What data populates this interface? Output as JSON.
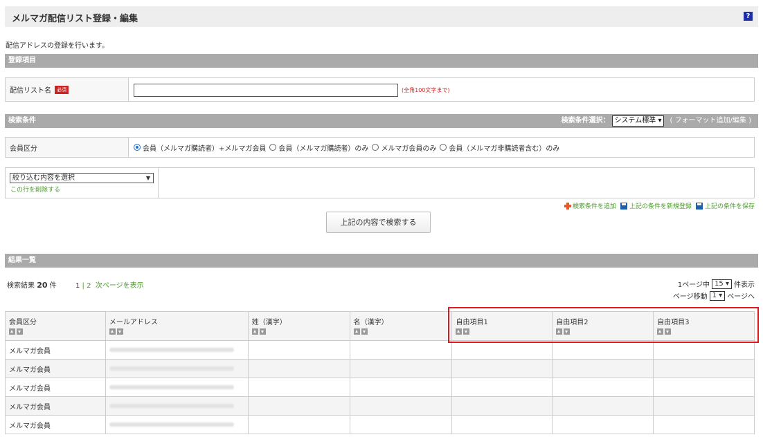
{
  "header": {
    "title": "メルマガ配信リスト登録・編集",
    "help_label": "?"
  },
  "description": "配信アドレスの登録を行います。",
  "registration": {
    "section_title": "登録項目",
    "list_name_label": "配信リスト名",
    "required_badge": "必須",
    "list_name_value": "",
    "input_note": "(全角100文字まで)"
  },
  "search": {
    "section_title": "検索条件",
    "format_label": "検索条件選択：",
    "format_selected": "システム標準 ▾",
    "format_link": "( フォーマット追加/編集 )",
    "member_type_label": "会員区分",
    "radio_options": [
      {
        "label": "会員（メルマガ購読者）+メルマガ会員",
        "checked": true
      },
      {
        "label": "会員（メルマガ購読者）のみ",
        "checked": false
      },
      {
        "label": "メルマガ会員のみ",
        "checked": false
      },
      {
        "label": "会員（メルマガ非購読者含む）のみ",
        "checked": false
      }
    ],
    "filter_select": "絞り込む内容を選択",
    "delete_row_link": "この行を削除する",
    "add_condition": "検索条件を追加",
    "register_new": "上記の条件を新規登録",
    "save_condition": "上記の条件を保存",
    "search_button": "上記の内容で検索する"
  },
  "results": {
    "section_title": "結果一覧",
    "count_prefix": "検索結果 ",
    "count_value": "20",
    "count_suffix": " 件",
    "pager_page1": "1",
    "pager_sep": " | ",
    "pager_page2": "2",
    "pager_next": "次ページを表示",
    "per_page_prefix": "1ページ中",
    "per_page_value": "15 ▾",
    "per_page_suffix": "件表示",
    "page_move_prefix": "ページ移動",
    "page_move_value": "1 ▾",
    "page_move_suffix": "ページへ",
    "columns": [
      "会員区分",
      "メールアドレス",
      "姓（漢字）",
      "名（漢字）",
      "自由項目1",
      "自由項目2",
      "自由項目3"
    ],
    "rows": [
      {
        "member_type": "メルマガ会員"
      },
      {
        "member_type": "メルマガ会員"
      },
      {
        "member_type": "メルマガ会員"
      },
      {
        "member_type": "メルマガ会員"
      },
      {
        "member_type": "メルマガ会員"
      }
    ]
  },
  "colors": {
    "highlight": "#e0191f",
    "section_bar": "#aaaaaa",
    "link_green": "#4a9a2a",
    "required_red": "#cc2222"
  }
}
